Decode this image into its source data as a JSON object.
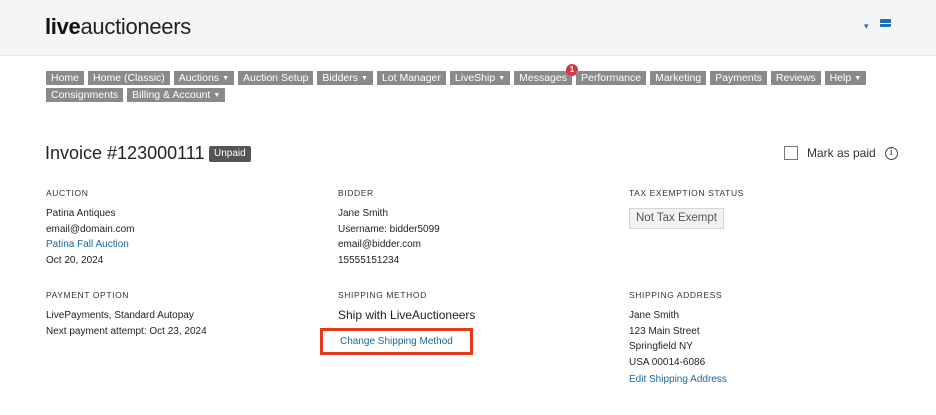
{
  "brand": {
    "bold": "live",
    "light": "auctioneers"
  },
  "top_icons": {
    "caret": "▾",
    "mail": "envelope-icon"
  },
  "nav": [
    {
      "label": "Home",
      "caret": false
    },
    {
      "label": "Home (Classic)",
      "caret": false
    },
    {
      "label": "Auctions",
      "caret": true
    },
    {
      "label": "Auction Setup",
      "caret": false
    },
    {
      "label": "Bidders",
      "caret": true
    },
    {
      "label": "Lot Manager",
      "caret": false
    },
    {
      "label": "LiveShip",
      "caret": true
    },
    {
      "label": "Messages",
      "caret": false,
      "badge": "1"
    },
    {
      "label": "Performance",
      "caret": false
    },
    {
      "label": "Marketing",
      "caret": false
    },
    {
      "label": "Payments",
      "caret": false
    },
    {
      "label": "Reviews",
      "caret": false
    },
    {
      "label": "Help",
      "caret": true
    },
    {
      "label": "Consignments",
      "caret": false
    },
    {
      "label": "Billing & Account",
      "caret": true
    }
  ],
  "invoice": {
    "title": "Invoice #123000111",
    "status": "Unpaid",
    "mark_paid_label": "Mark as paid",
    "info_icon": "i"
  },
  "auction": {
    "heading": "AUCTION",
    "seller": "Patina Antiques",
    "email": "email@domain.com",
    "auction_link": "Patina Fall Auction",
    "date": "Oct 20, 2024"
  },
  "bidder": {
    "heading": "BIDDER",
    "name": "Jane Smith",
    "username": "Username: bidder5099",
    "email": "email@bidder.com",
    "phone": "15555151234"
  },
  "tax": {
    "heading": "TAX EXEMPTION STATUS",
    "status": "Not Tax Exempt"
  },
  "payment": {
    "heading": "PAYMENT OPTION",
    "method": "LivePayments, Standard Autopay",
    "next": "Next payment attempt: Oct 23, 2024"
  },
  "shipping_method": {
    "heading": "SHIPPING METHOD",
    "value": "Ship with LiveAuctioneers",
    "change_link": "Change Shipping Method",
    "highlight_color": "#e03a1a"
  },
  "shipping_address": {
    "heading": "SHIPPING ADDRESS",
    "name": "Jane Smith",
    "street": "123 Main Street",
    "city": "Springfield NY",
    "country_zip": "USA 00014-6086",
    "edit_link": "Edit Shipping Address"
  },
  "colors": {
    "link": "#1c6a9e",
    "nav_bg": "#8a8a8a",
    "badge": "#d9363e",
    "brand_blue": "#1f6fb5"
  }
}
